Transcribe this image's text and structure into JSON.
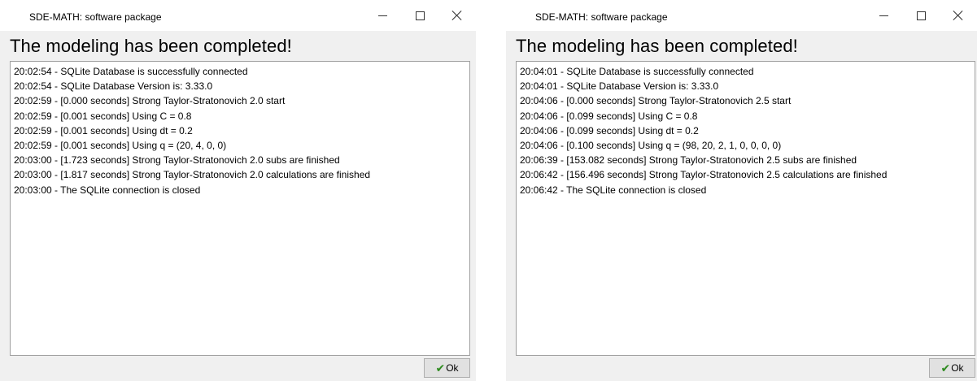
{
  "windows": [
    {
      "title": "SDE-MATH: software package",
      "heading": "The modeling has been completed!",
      "log": [
        "20:02:54 - SQLite Database is successfully connected",
        "20:02:54 - SQLite Database Version is: 3.33.0",
        "20:02:59 - [0.000 seconds] Strong Taylor-Stratonovich 2.0 start",
        "20:02:59 - [0.001 seconds] Using C = 0.8",
        "20:02:59 - [0.001 seconds] Using dt = 0.2",
        "20:02:59 - [0.001 seconds] Using q = (20, 4, 0, 0)",
        "20:03:00 - [1.723 seconds] Strong Taylor-Stratonovich 2.0 subs are finished",
        "20:03:00 - [1.817 seconds] Strong Taylor-Stratonovich 2.0 calculations are finished",
        "20:03:00 - The SQLite connection is closed"
      ],
      "ok_label": "Ok",
      "check_icon": "✔",
      "controls": {
        "close": "close-icon",
        "maximize": "maximize-icon",
        "minimize": "minimize-icon"
      }
    },
    {
      "title": "SDE-MATH: software package",
      "heading": "The modeling has been completed!",
      "log": [
        "20:04:01 - SQLite Database is successfully connected",
        "20:04:01 - SQLite Database Version is: 3.33.0",
        "20:04:06 - [0.000 seconds] Strong Taylor-Stratonovich 2.5 start",
        "20:04:06 - [0.099 seconds] Using C = 0.8",
        "20:04:06 - [0.099 seconds] Using dt = 0.2",
        "20:04:06 - [0.100 seconds] Using q = (98, 20, 2, 1, 0, 0, 0, 0)",
        "20:06:39 - [153.082 seconds] Strong Taylor-Stratonovich 2.5 subs are finished",
        "20:06:42 - [156.496 seconds] Strong Taylor-Stratonovich 2.5 calculations are finished",
        "20:06:42 - The SQLite connection is closed"
      ],
      "ok_label": "Ok",
      "check_icon": "✔",
      "controls": {
        "close": "close-icon",
        "maximize": "maximize-icon",
        "minimize": "minimize-icon"
      }
    }
  ],
  "colors": {
    "window_background": "#f0f0f0",
    "titlebar_background": "#ffffff",
    "log_background": "#ffffff",
    "check_icon": "#2e8b1f"
  }
}
